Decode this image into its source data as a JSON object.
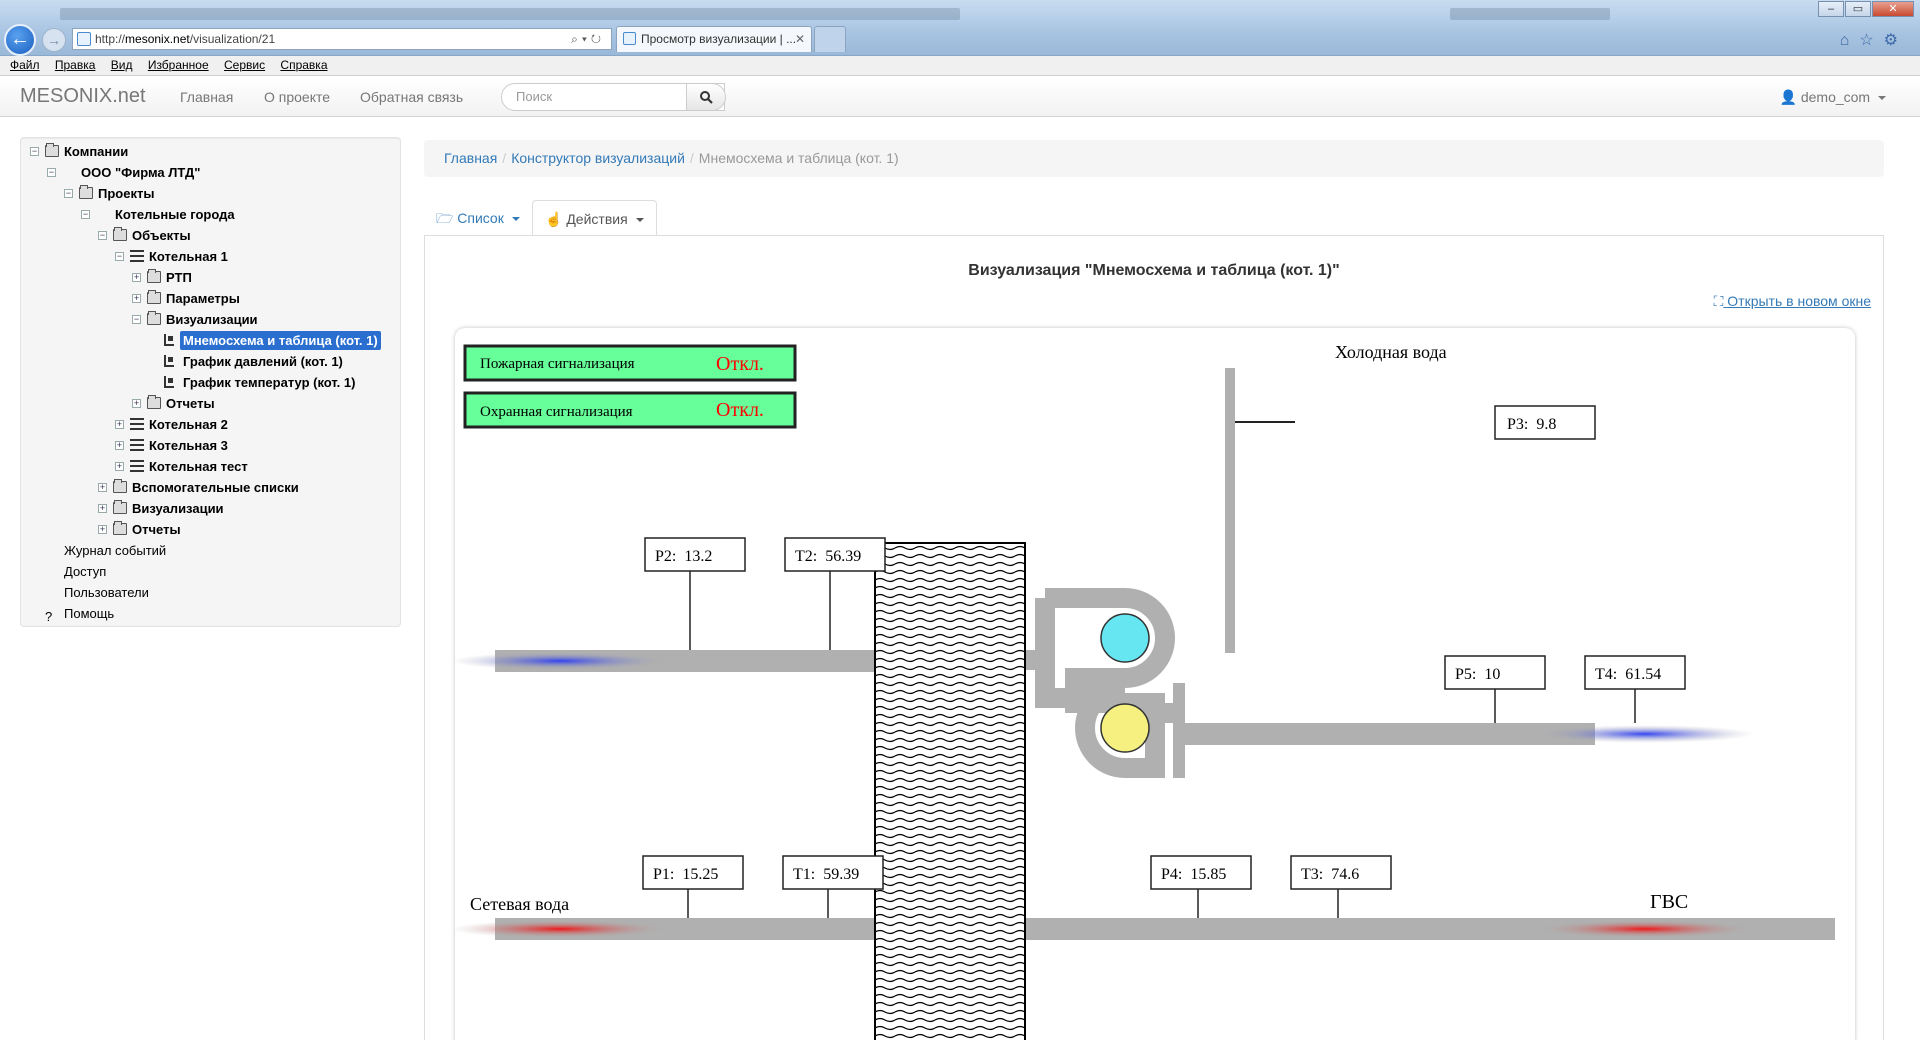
{
  "browser": {
    "url_prefix": "http://",
    "url_host": "mesonix.net",
    "url_path": "/visualization/21",
    "tab_title": "Просмотр визуализации | ...",
    "menu": [
      "Файл",
      "Правка",
      "Вид",
      "Избранное",
      "Сервис",
      "Справка"
    ]
  },
  "navbar": {
    "brand": "MESONIX.net",
    "links": [
      "Главная",
      "О проекте",
      "Обратная связь"
    ],
    "search_placeholder": "Поиск",
    "user": "demo_com"
  },
  "tree": {
    "items": [
      {
        "label": "Компании",
        "level": 0,
        "icon": "folder-open-icon",
        "expander": "minus",
        "bold": true
      },
      {
        "label": "ООО \"Фирма ЛТД\"",
        "level": 1,
        "icon": "building-icon",
        "expander": "minus",
        "bold": true
      },
      {
        "label": "Проекты",
        "level": 2,
        "icon": "folder-open-icon",
        "expander": "minus",
        "bold": true
      },
      {
        "label": "Котельные города",
        "level": 3,
        "icon": "computer-icon",
        "expander": "minus",
        "bold": true
      },
      {
        "label": "Объекты",
        "level": 4,
        "icon": "folder-open-icon",
        "expander": "minus",
        "bold": true
      },
      {
        "label": "Котельная 1",
        "level": 5,
        "icon": "list-icon",
        "expander": "minus",
        "bold": true
      },
      {
        "label": "РТП",
        "level": 6,
        "icon": "folder-icon",
        "expander": "plus",
        "bold": true
      },
      {
        "label": "Параметры",
        "level": 6,
        "icon": "folder-icon",
        "expander": "plus",
        "bold": true
      },
      {
        "label": "Визуализации",
        "level": 6,
        "icon": "folder-open-icon",
        "expander": "minus",
        "bold": true
      },
      {
        "label": "Мнемосхема и таблица (кот. 1)",
        "level": 7,
        "icon": "chart-icon",
        "expander": "",
        "bold": true,
        "selected": true
      },
      {
        "label": "График давлений (кот. 1)",
        "level": 7,
        "icon": "chart-icon",
        "expander": "",
        "bold": true
      },
      {
        "label": "График температур (кот. 1)",
        "level": 7,
        "icon": "chart-icon",
        "expander": "",
        "bold": true
      },
      {
        "label": "Отчеты",
        "level": 6,
        "icon": "folder-icon",
        "expander": "plus",
        "bold": true
      },
      {
        "label": "Котельная 2",
        "level": 5,
        "icon": "list-icon",
        "expander": "plus",
        "bold": true
      },
      {
        "label": "Котельная 3",
        "level": 5,
        "icon": "list-icon",
        "expander": "plus",
        "bold": true
      },
      {
        "label": "Котельная тест",
        "level": 5,
        "icon": "list-icon",
        "expander": "plus",
        "bold": true
      },
      {
        "label": "Вспомогательные списки",
        "level": 4,
        "icon": "folder-icon",
        "expander": "plus",
        "bold": true
      },
      {
        "label": "Визуализации",
        "level": 4,
        "icon": "folder-icon",
        "expander": "plus",
        "bold": true
      },
      {
        "label": "Отчеты",
        "level": 4,
        "icon": "folder-icon",
        "expander": "plus",
        "bold": true
      },
      {
        "label": "Журнал событий",
        "level": 0,
        "icon": "book-icon",
        "expander": "",
        "bold": false
      },
      {
        "label": "Доступ",
        "level": 0,
        "icon": "lock-icon",
        "expander": "",
        "bold": false
      },
      {
        "label": "Пользователи",
        "level": 0,
        "icon": "users-icon",
        "expander": "",
        "bold": false
      },
      {
        "label": "Помощь",
        "level": 0,
        "icon": "help-icon",
        "expander": "",
        "bold": false
      }
    ]
  },
  "breadcrumb": {
    "items": [
      "Главная",
      "Конструктор визуализаций",
      "Мнемосхема и таблица (кот. 1)"
    ]
  },
  "tabs": {
    "list": "Список",
    "actions": "Действия"
  },
  "viz": {
    "title": "Визуализация \"Мнемосхема и таблица (кот. 1)\"",
    "open_new": "Открыть в новом окне",
    "alarms": [
      {
        "label": "Пожарная сигнализация",
        "state": "Откл."
      },
      {
        "label": "Охранная сигнализация",
        "state": "Откл."
      }
    ],
    "labels": {
      "cold_water": "Холодная вода",
      "network_water": "Сетевая вода",
      "hot_water": "ГВС"
    },
    "readings": {
      "P3": {
        "name": "P3:",
        "value": "9.8"
      },
      "P2": {
        "name": "P2:",
        "value": "13.2"
      },
      "T2": {
        "name": "T2:",
        "value": "56.39"
      },
      "P5": {
        "name": "P5:",
        "value": "10"
      },
      "T4": {
        "name": "T4:",
        "value": "61.54"
      },
      "P1": {
        "name": "P1:",
        "value": "15.25"
      },
      "T1": {
        "name": "T1:",
        "value": "59.39"
      },
      "P4": {
        "name": "P4:",
        "value": "15.85"
      },
      "T3": {
        "name": "T3:",
        "value": "74.6"
      }
    },
    "colors": {
      "alarm_bg": "#66ff99",
      "alarm_text": "#ff0000",
      "pipe": "#b0b0b0",
      "pump_cold": "#66e6f0",
      "pump_hot": "#f5f080",
      "flow_cold": "#2a3cf0",
      "flow_hot": "#f01010"
    }
  }
}
